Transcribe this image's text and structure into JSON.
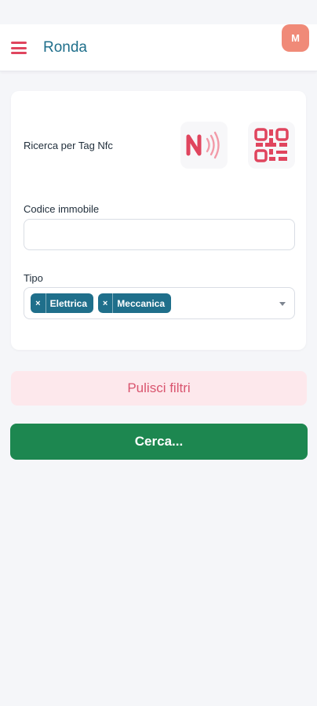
{
  "header": {
    "title": "Ronda",
    "avatar_initial": "M"
  },
  "filters": {
    "nfc_label": "Ricerca per Tag Nfc",
    "codice_label": "Codice immobile",
    "codice_value": "",
    "tipo_label": "Tipo",
    "tipo_selected": [
      {
        "label": "Elettrica",
        "remove": "×"
      },
      {
        "label": "Meccanica",
        "remove": "×"
      }
    ]
  },
  "actions": {
    "reset_label": "Pulisci filtri",
    "search_label": "Cerca..."
  },
  "icons": {
    "menu": "hamburger-icon",
    "nfc": "nfc-icon",
    "qr": "qr-code-icon",
    "dropdown": "chevron-down-icon"
  },
  "colors": {
    "accent_red": "#e0455e",
    "title_blue": "#1f6f8b",
    "avatar_bg": "#f08a78",
    "chip_bg": "#1f6f8b",
    "search_green": "#1d8750",
    "reset_bg": "#fde8ec"
  }
}
